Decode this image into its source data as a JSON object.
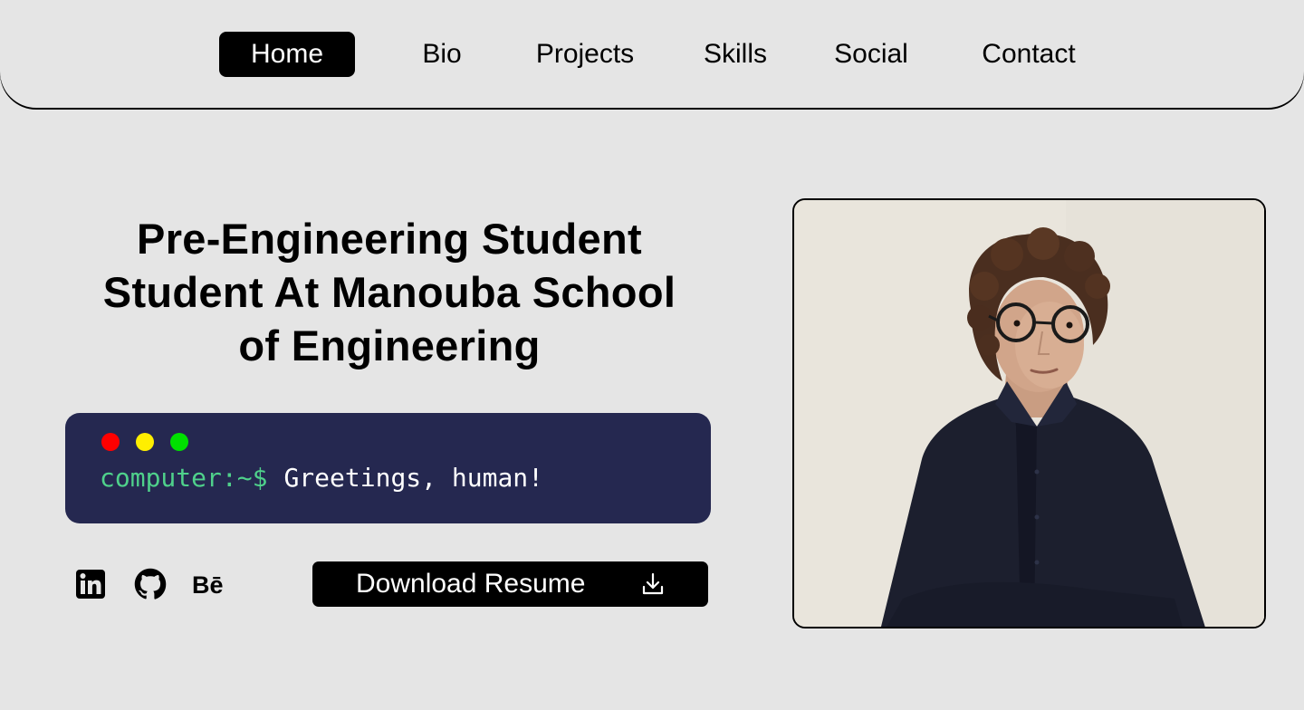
{
  "nav": {
    "items": [
      {
        "label": "Home",
        "active": true
      },
      {
        "label": "Bio"
      },
      {
        "label": "Projects"
      },
      {
        "label": "Skills"
      },
      {
        "label": "Social"
      },
      {
        "label": "Contact"
      }
    ]
  },
  "hero": {
    "headline_lines": [
      "Pre-Engineering Student",
      "Student At Manouba School",
      "of Engineering"
    ]
  },
  "terminal": {
    "prompt": "computer:~$",
    "text": "Greetings, human!",
    "dot_colors": [
      "#ff0000",
      "#ffef00",
      "#00e000"
    ],
    "bg_color": "#252850"
  },
  "social": {
    "icons": [
      "linkedin-icon",
      "github-icon",
      "behance-icon"
    ]
  },
  "download": {
    "label": "Download Resume",
    "icon": "download-icon"
  },
  "colors": {
    "background": "#e5e5e5",
    "accent": "#000000",
    "prompt": "#4fd18b"
  }
}
